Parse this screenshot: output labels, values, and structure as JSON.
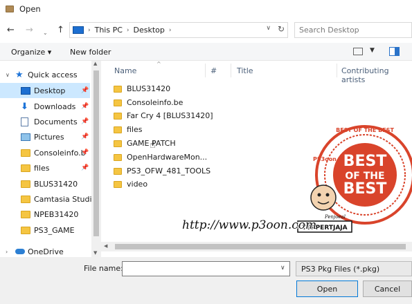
{
  "window": {
    "title": "Open"
  },
  "address": {
    "crumbs": [
      "This PC",
      "Desktop"
    ],
    "search_placeholder": "Search Desktop"
  },
  "toolbar": {
    "organize": "Organize ▾",
    "new_folder": "New folder"
  },
  "nav": {
    "quick_access": "Quick access",
    "items": [
      {
        "label": "Desktop",
        "pinned": true,
        "icon": "desktop-icon"
      },
      {
        "label": "Downloads",
        "pinned": true,
        "icon": "download-icon"
      },
      {
        "label": "Documents",
        "pinned": true,
        "icon": "documents-icon"
      },
      {
        "label": "Pictures",
        "pinned": true,
        "icon": "pictures-icon"
      },
      {
        "label": "Consoleinfo.b",
        "pinned": true,
        "icon": "folder-icon"
      },
      {
        "label": "files",
        "pinned": true,
        "icon": "folder-icon"
      },
      {
        "label": "BLUS31420",
        "pinned": false,
        "icon": "folder-icon"
      },
      {
        "label": "Camtasia Studio",
        "pinned": false,
        "icon": "folder-icon"
      },
      {
        "label": "NPEB31420",
        "pinned": false,
        "icon": "folder-icon"
      },
      {
        "label": "PS3_GAME",
        "pinned": false,
        "icon": "folder-icon"
      }
    ],
    "onedrive": "OneDrive"
  },
  "columns": {
    "name": "Name",
    "num": "#",
    "title": "Title",
    "artists": "Contributing artists"
  },
  "files": [
    "BLUS31420",
    "Consoleinfo.be",
    "Far Cry 4 [BLUS31420]",
    "files",
    "GAME PATCH",
    "OpenHardwareMon...",
    "PS3_OFW_481_TOOLS",
    "video"
  ],
  "bottom": {
    "file_name_label": "File name:",
    "file_name_value": "",
    "file_type": "PS3 Pkg Files (*.pkg)",
    "open": "Open",
    "cancel": "Cancel"
  },
  "watermark": {
    "url": "http://www.p3oon.com",
    "badge_main": [
      "BEST",
      "OF THE",
      "BEST"
    ],
    "badge_ring": "BEST OF THE BEST",
    "seller": "Penjoeal",
    "seller_tag": "TERPERTJAJA",
    "logo_left": "PS3oon"
  },
  "colors": {
    "accent": "#0078d7",
    "selected": "#cce8ff",
    "folder": "#f5c542",
    "stamp": "#d9442b"
  }
}
